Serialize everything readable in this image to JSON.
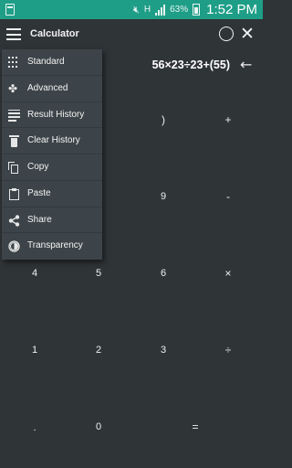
{
  "status_bar": {
    "network": "H",
    "battery": "63%",
    "time": "1:52 PM"
  },
  "toolbar": {
    "title": "Calculator"
  },
  "display": {
    "expression": "56×23÷23+(55)"
  },
  "keypad": {
    "rparen": ")",
    "plus": "+",
    "nine": "9",
    "minus": "-",
    "four": "4",
    "five": "5",
    "six": "6",
    "multiply": "×",
    "one": "1",
    "two": "2",
    "three": "3",
    "divide": "÷",
    "dot": ".",
    "zero": "0",
    "equals": "="
  },
  "menu": {
    "items": [
      {
        "label": "Standard",
        "icon": "dial-pad-icon"
      },
      {
        "label": "Advanced",
        "icon": "puzzle-icon"
      },
      {
        "label": "Result History",
        "icon": "list-icon"
      },
      {
        "label": "Clear History",
        "icon": "trash-icon"
      },
      {
        "label": "Copy",
        "icon": "copy-icon"
      },
      {
        "label": "Paste",
        "icon": "clipboard-icon"
      },
      {
        "label": "Share",
        "icon": "share-icon"
      },
      {
        "label": "Transparency",
        "icon": "brightness-icon"
      }
    ]
  },
  "colors": {
    "status_bar": "#1f9e87",
    "background": "#2f3437",
    "menu": "#3c4449"
  }
}
